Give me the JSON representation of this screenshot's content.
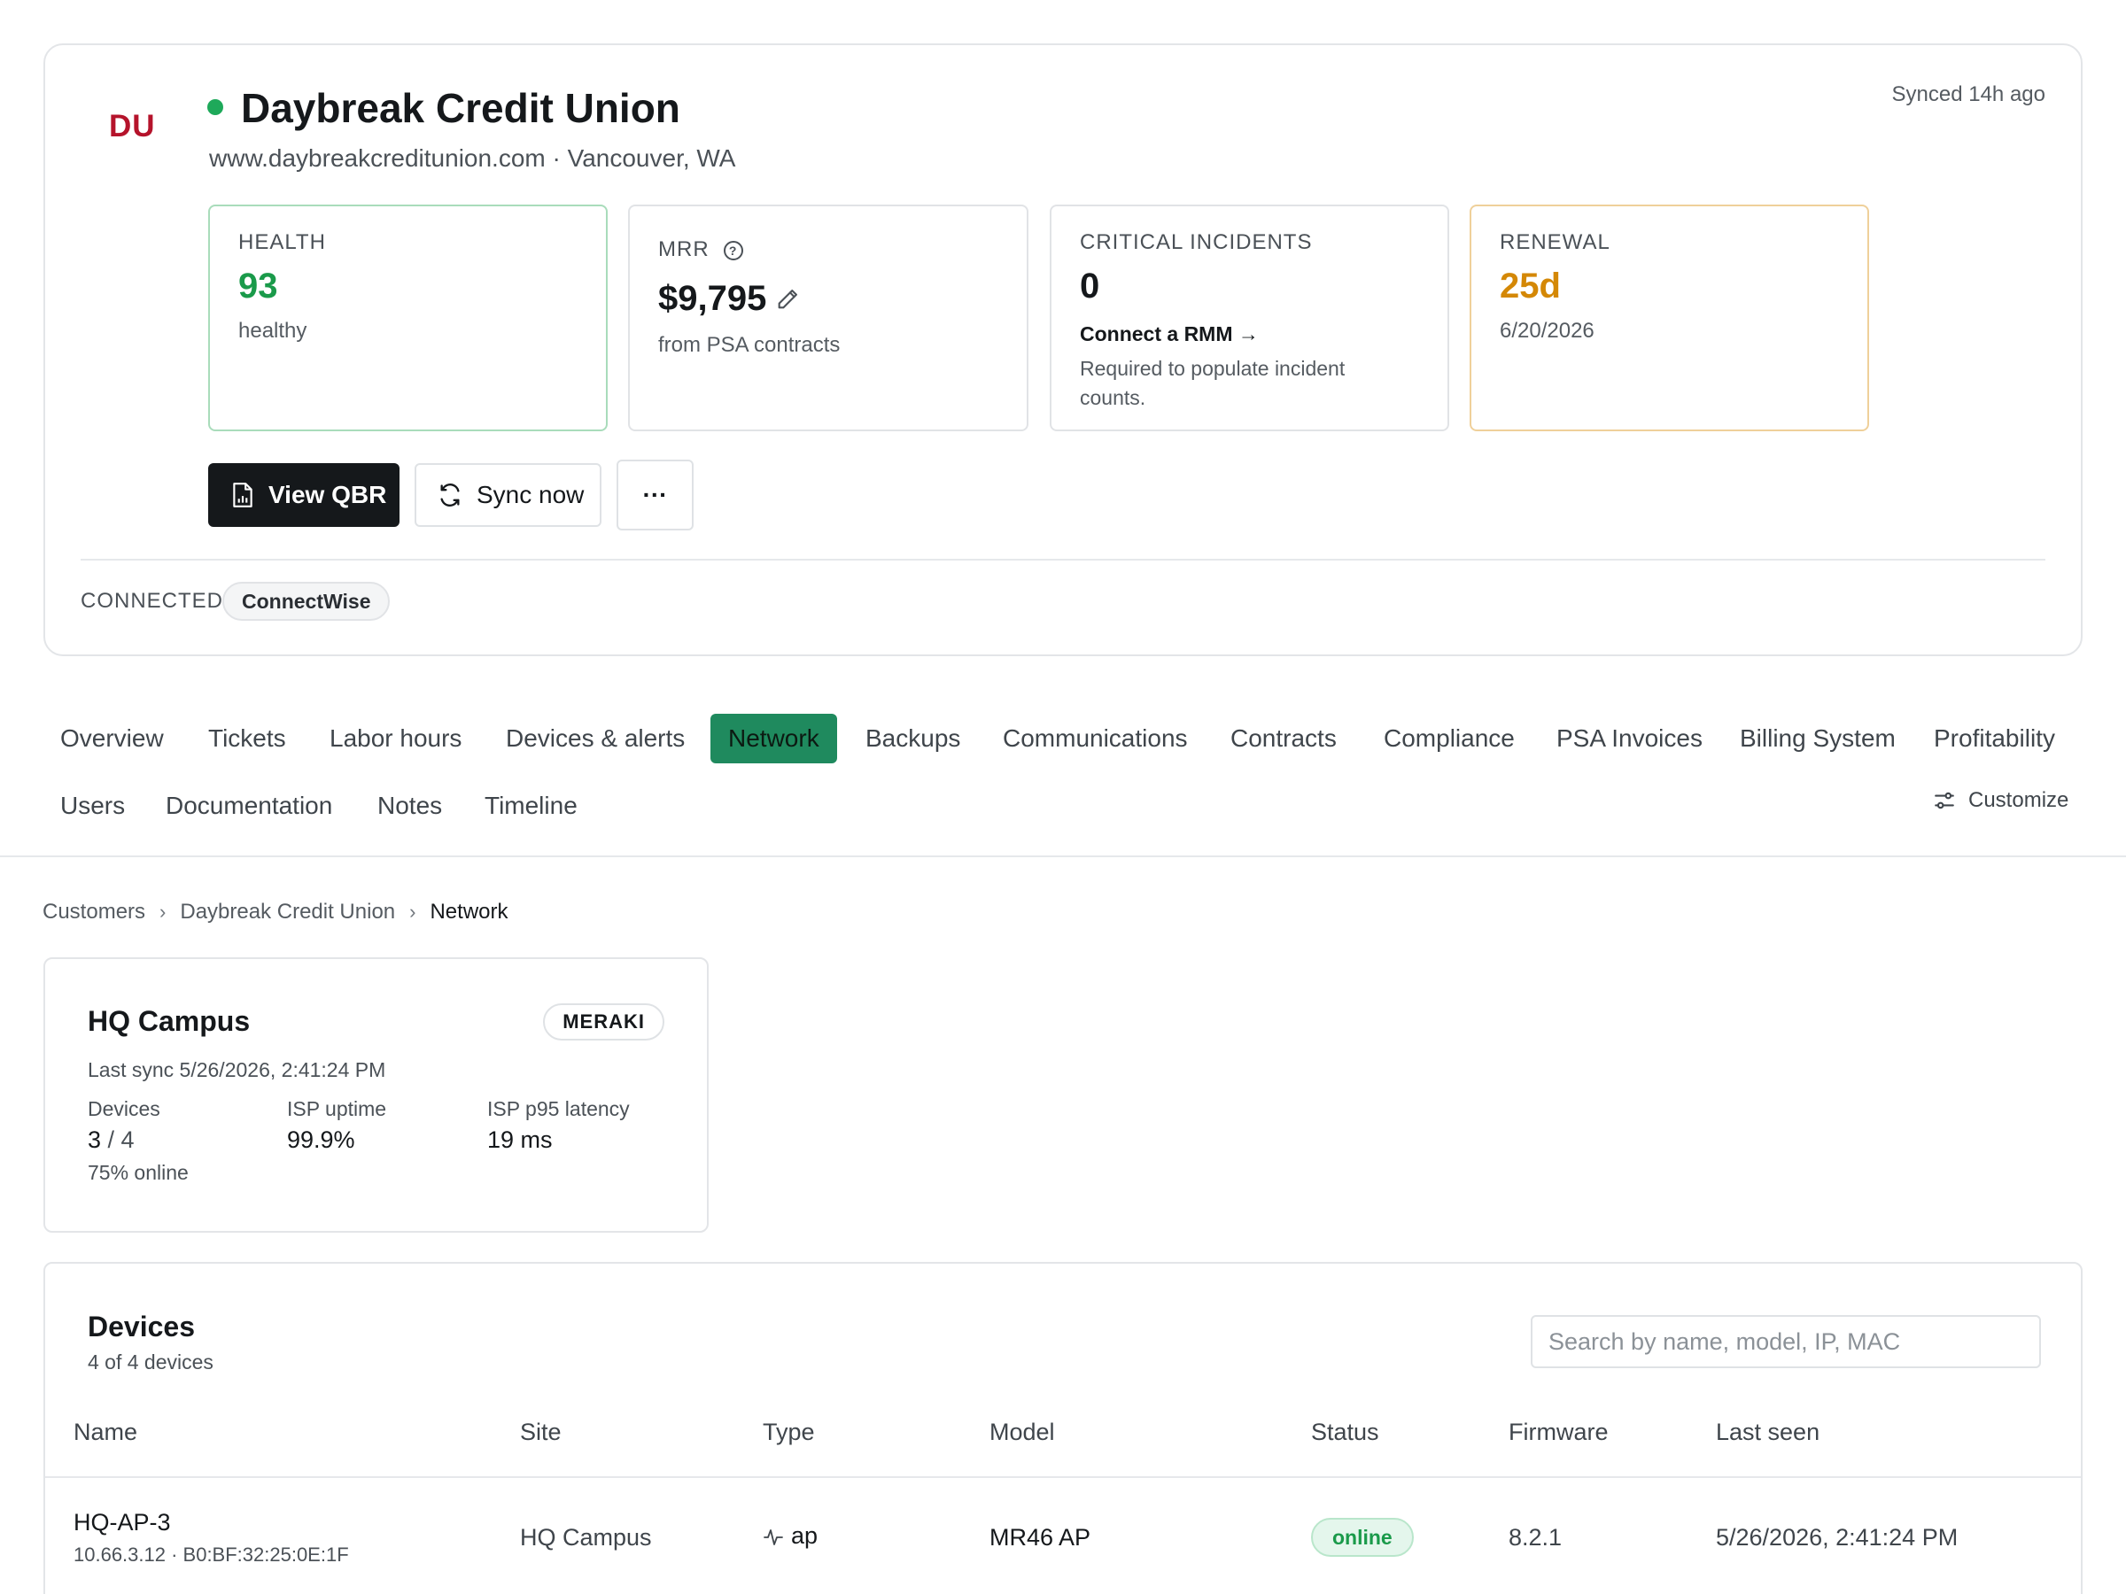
{
  "customer": {
    "logo_text": "DU",
    "name": "Daybreak Credit Union",
    "subtitle": "www.daybreakcreditunion.com · Vancouver, WA",
    "synced": "Synced 14h ago",
    "status_color": "#1ea95a"
  },
  "kpis": {
    "health": {
      "label": "HEALTH",
      "value": "93",
      "sub": "healthy"
    },
    "mrr": {
      "label": "MRR",
      "value": "$9,795",
      "sub": "from PSA contracts"
    },
    "critical": {
      "label": "CRITICAL INCIDENTS",
      "value": "0",
      "link": "Connect a RMM →",
      "note": "Required to populate incident counts."
    },
    "renewal": {
      "label": "RENEWAL",
      "value": "25d",
      "sub": "6/20/2026"
    }
  },
  "actions": {
    "view_qbr": "View QBR",
    "sync_now": "Sync now",
    "more": "···"
  },
  "connected": {
    "label": "CONNECTED",
    "integration": "ConnectWise"
  },
  "tabs": [
    "Overview",
    "Tickets",
    "Labor hours",
    "Devices & alerts",
    "Network",
    "Backups",
    "Communications",
    "Contracts",
    "Compliance",
    "PSA Invoices",
    "Billing System",
    "Profitability",
    "Users",
    "Documentation",
    "Notes",
    "Timeline"
  ],
  "active_tab": "Network",
  "customize_label": "Customize",
  "breadcrumb": [
    "Customers",
    "Daybreak Credit Union",
    "Network"
  ],
  "site": {
    "name": "HQ Campus",
    "vendor": "MERAKI",
    "last_sync": "Last sync 5/26/2026, 2:41:24 PM",
    "stats": {
      "devices_label": "Devices",
      "devices_online": "3",
      "devices_total": "/ 4",
      "devices_note": "75% online",
      "uptime_label": "ISP uptime",
      "uptime_value": "99.9%",
      "latency_label": "ISP p95 latency",
      "latency_value": "19 ms"
    }
  },
  "devices": {
    "title": "Devices",
    "count": "4 of 4 devices",
    "search_placeholder": "Search by name, model, IP, MAC",
    "columns": [
      "Name",
      "Site",
      "Type",
      "Model",
      "Status",
      "Firmware",
      "Last seen"
    ],
    "rows": [
      {
        "name": "HQ-AP-3",
        "meta": "10.66.3.12 · B0:BF:32:25:0E:1F",
        "site": "HQ Campus",
        "type": "ap",
        "model": "MR46 AP",
        "status": "online",
        "firmware": "8.2.1",
        "last_seen": "5/26/2026, 2:41:24 PM"
      }
    ]
  },
  "colors": {
    "accent": "#1f8a5e",
    "health": "#1a9a4a",
    "renewal": "#d48806",
    "logo": "#b5132b"
  }
}
